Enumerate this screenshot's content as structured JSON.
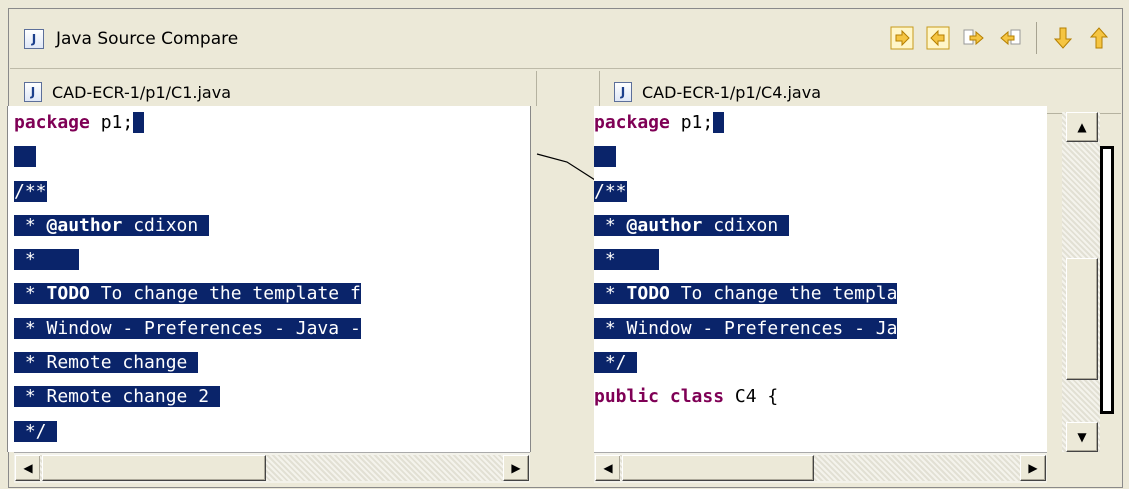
{
  "window": {
    "title": "Java Source Compare",
    "icon": "java-file-icon",
    "icon_glyph": "J"
  },
  "toolbar": {
    "buttons": [
      {
        "name": "copy-all-left-to-right",
        "icon": "copy-all-right-icon"
      },
      {
        "name": "copy-all-right-to-left",
        "icon": "copy-all-left-icon"
      },
      {
        "name": "copy-current-left-to-right",
        "icon": "copy-current-right-icon"
      },
      {
        "name": "copy-current-right-to-left",
        "icon": "copy-current-left-icon"
      },
      {
        "name": "next-difference",
        "icon": "arrow-down-icon"
      },
      {
        "name": "previous-difference",
        "icon": "arrow-up-icon"
      }
    ]
  },
  "left_pane": {
    "file": "CAD-ECR-1/p1/C1.java",
    "lines": [
      {
        "kw": "package",
        "rest": " p1;"
      },
      {
        "kw": "",
        "rest": ""
      },
      {
        "kw": "",
        "rest": "/**"
      },
      {
        "pre": " * ",
        "kw": "@author",
        "rest": " cdixon"
      },
      {
        "kw": "",
        "rest": " *"
      },
      {
        "pre": " * ",
        "kw": "TODO",
        "rest": " To change the template f"
      },
      {
        "kw": "",
        "rest": " * Window - Preferences - Java -"
      },
      {
        "kw": "",
        "rest": " * Remote change"
      },
      {
        "kw": "",
        "rest": " * Remote change 2"
      },
      {
        "kw": "",
        "rest": " */"
      }
    ]
  },
  "right_pane": {
    "file": "CAD-ECR-1/p1/C4.java",
    "lines": [
      {
        "kw": "package",
        "rest": " p1;"
      },
      {
        "kw": "",
        "rest": ""
      },
      {
        "kw": "",
        "rest": "/**"
      },
      {
        "pre": " * ",
        "kw": "@author",
        "rest": " cdixon"
      },
      {
        "kw": "",
        "rest": " *"
      },
      {
        "pre": " * ",
        "kw": "TODO",
        "rest": " To change the templa"
      },
      {
        "kw": "",
        "rest": " * Window - Preferences - Ja"
      },
      {
        "kw": "",
        "rest": " */"
      },
      {
        "kw": "public class",
        "rest": " C4 {"
      }
    ]
  },
  "scroll": {
    "left_arrow": "◀",
    "right_arrow": "▶",
    "up_arrow": "▲",
    "down_arrow": "▼"
  },
  "colors": {
    "selection": "#0a246a",
    "keyword": "#7f0055",
    "chrome": "#ece9d8"
  }
}
